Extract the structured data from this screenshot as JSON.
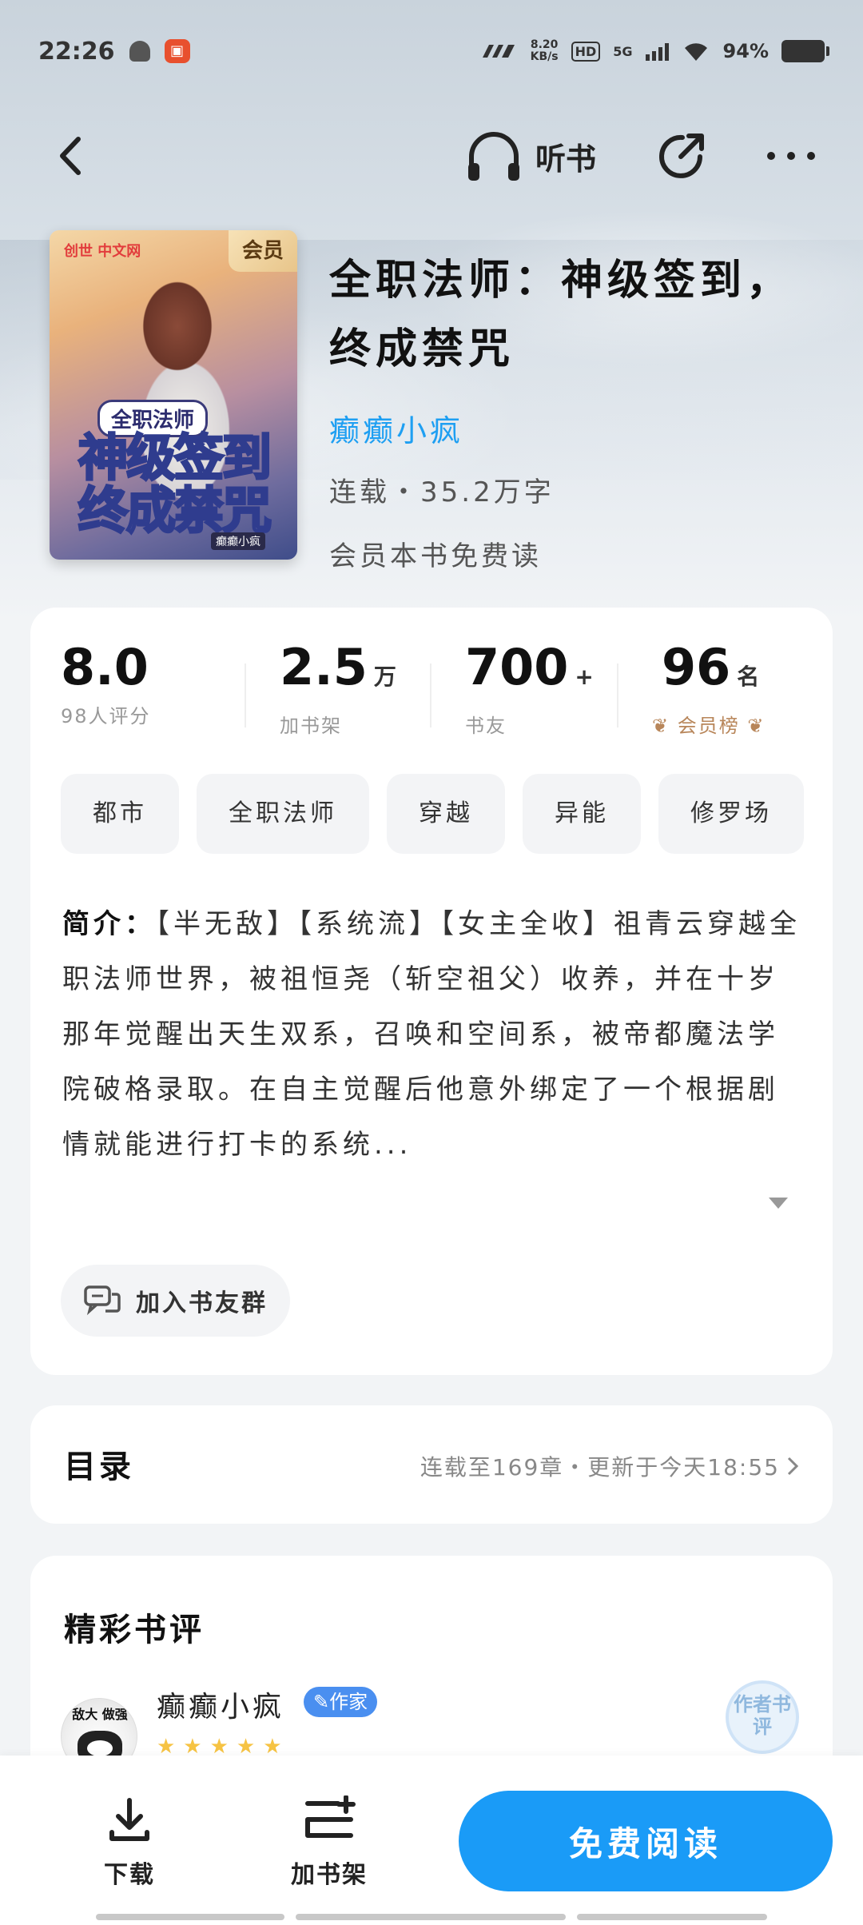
{
  "status_bar": {
    "time": "22:26",
    "net_speed_value": "8.20",
    "net_speed_unit": "KB/s",
    "hd": "HD",
    "signal": "5G",
    "battery": "94%"
  },
  "nav": {
    "listen_label": "听书"
  },
  "cover": {
    "badge": "会员",
    "brand": "创世 中文网",
    "title_line1": "全职法师",
    "title_line2": "神级签到",
    "title_line3": "终成禁咒",
    "author_tag": "癫癫小疯"
  },
  "book": {
    "title": "全职法师：神级签到，终成禁咒",
    "author": "癫癫小疯",
    "meta": "连载・35.2万字",
    "note": "会员本书免费读"
  },
  "stats": {
    "rating": "8.0",
    "rating_label": "98人评分",
    "shelf": "2.5",
    "shelf_unit": "万",
    "shelf_label": "加书架",
    "fans": "700",
    "fans_unit": "+",
    "fans_label": "书友",
    "rank": "96",
    "rank_unit": "名",
    "rank_label": "会员榜"
  },
  "tags": [
    "都市",
    "全职法师",
    "穿越",
    "异能",
    "修罗场"
  ],
  "synopsis": {
    "lead": "简介：",
    "text": "【半无敌】【系统流】【女主全收】祖青云穿越全职法师世界，被祖恒尧（斩空祖父）收养，并在十岁那年觉醒出天生双系，召唤和空间系，被帝都魔法学院破格录取。在自主觉醒后他意外绑定了一个根据剧情就能进行打卡的系统..."
  },
  "group_button": "加入书友群",
  "toc": {
    "title": "目录",
    "info": "连载至169章・更新于今天18:55"
  },
  "reviews": {
    "title": "精彩书评",
    "avatar_caption": "敌大 做强",
    "reviewer": "癫癫小疯",
    "badge": "作家",
    "stars": "★★★★★",
    "seal": "作者书评"
  },
  "bottom": {
    "download": "下载",
    "add_shelf": "加书架",
    "read": "免费阅读"
  },
  "colors": {
    "accent": "#1a9bf7",
    "author_link": "#1e9ff2",
    "rank_gold": "#b8865a"
  }
}
